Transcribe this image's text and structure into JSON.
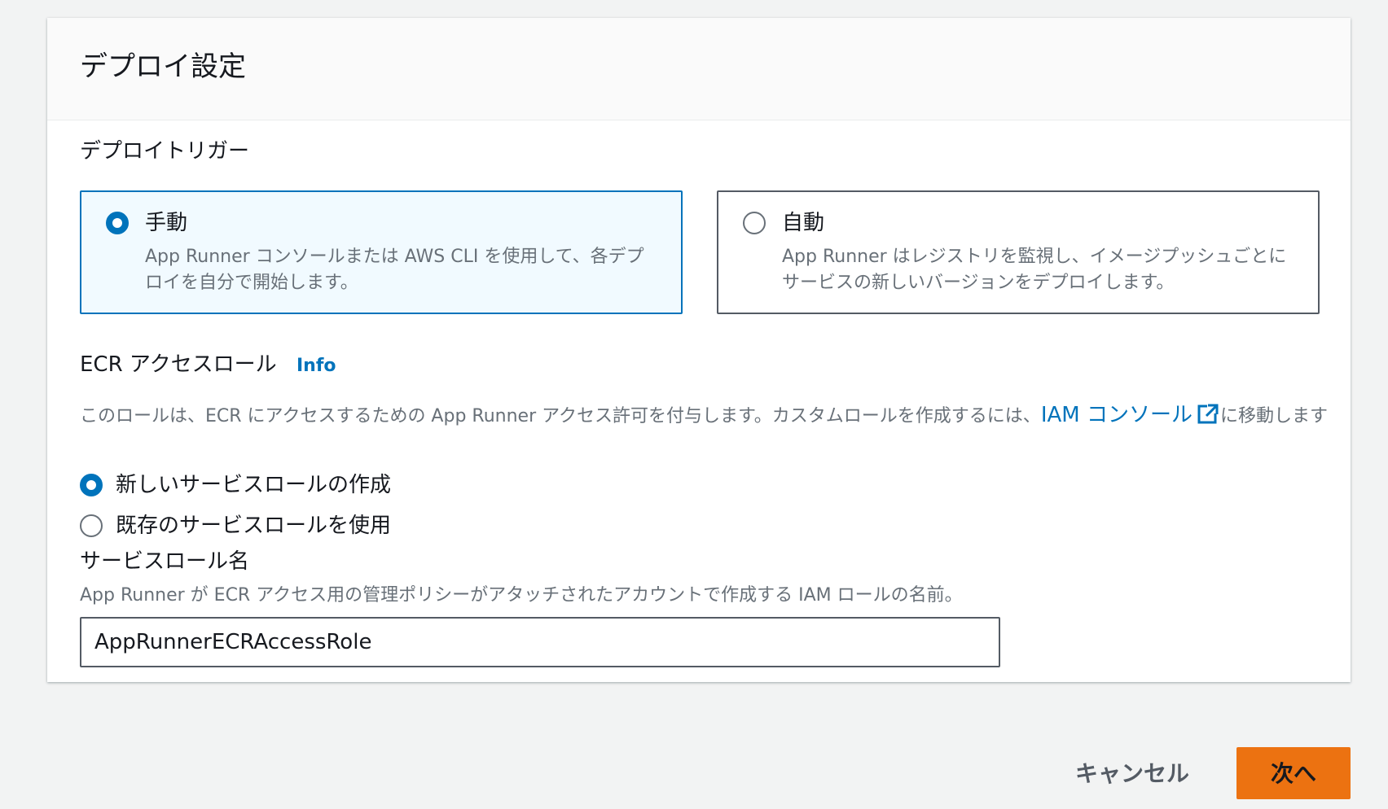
{
  "panel": {
    "title": "デプロイ設定"
  },
  "deploy_trigger": {
    "label": "デプロイトリガー",
    "options": [
      {
        "title": "手動",
        "description": "App Runner コンソールまたは AWS CLI を使用して、各デプロイを自分で開始します。",
        "selected": true
      },
      {
        "title": "自動",
        "description": "App Runner はレジストリを監視し、イメージプッシュごとにサービスの新しいバージョンをデプロイします。",
        "selected": false
      }
    ]
  },
  "ecr_role": {
    "label": "ECR アクセスロール",
    "info_link": "Info",
    "description_before": "このロールは、ECR にアクセスするための App Runner アクセス許可を付与します。カスタムロールを作成するには、",
    "iam_link": "IAM コンソール",
    "description_after": "に移動します",
    "options": [
      {
        "label": "新しいサービスロールの作成",
        "selected": true
      },
      {
        "label": "既存のサービスロールを使用",
        "selected": false
      }
    ]
  },
  "service_role_name": {
    "label": "サービスロール名",
    "description": "App Runner が ECR アクセス用の管理ポリシーがアタッチされたアカウントで作成する IAM ロールの名前。",
    "value": "AppRunnerECRAccessRole"
  },
  "footer": {
    "cancel_label": "キャンセル",
    "next_label": "次へ"
  },
  "colors": {
    "accent": "#0073bb",
    "primary_button": "#ec7211",
    "selected_tile_bg": "#f1faff",
    "page_bg": "#f2f3f3"
  },
  "icons": {
    "external_link": "external-link-icon"
  }
}
